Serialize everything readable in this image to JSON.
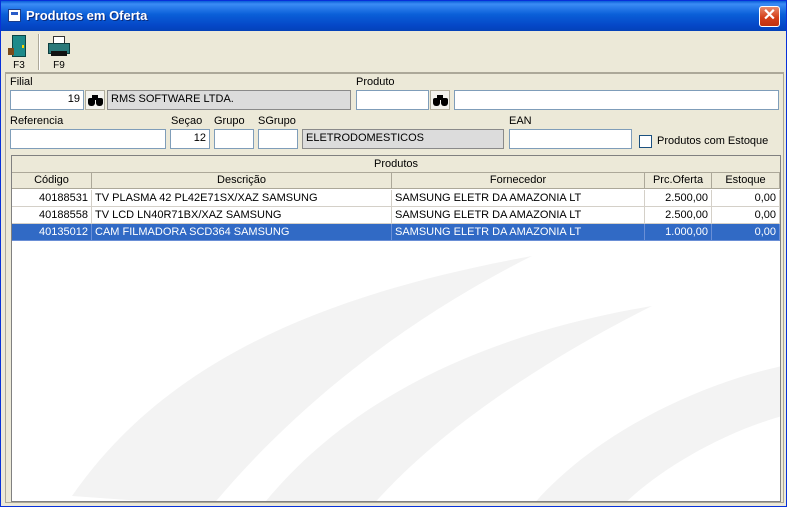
{
  "window": {
    "title": "Produtos em Oferta",
    "close_label": "✕"
  },
  "toolbar": {
    "buttons": [
      {
        "label": "F3",
        "icon": "exit-door-icon"
      },
      {
        "label": "F9",
        "icon": "printer-icon"
      }
    ]
  },
  "filters": {
    "filial_label": "Filial",
    "filial_value": "19",
    "filial_name": "RMS SOFTWARE LTDA.",
    "produto_label": "Produto",
    "produto_value": "",
    "produto_desc": "",
    "referencia_label": "Referencia",
    "referencia_value": "",
    "secao_label": "Seçao",
    "secao_value": "12",
    "grupo_label": "Grupo",
    "grupo_value": "",
    "sgrupo_label": "SGrupo",
    "sgrupo_value": "",
    "secao_desc": "ELETRODOMESTICOS",
    "ean_label": "EAN",
    "ean_value": "",
    "estoque_checkbox_label": "Produtos com Estoque",
    "estoque_checked": false
  },
  "grid": {
    "title": "Produtos",
    "columns": [
      "Código",
      "Descrição",
      "Fornecedor",
      "Prc.Oferta",
      "Estoque"
    ],
    "rows": [
      {
        "codigo": "40188531",
        "descricao": "TV PLASMA 42 PL42E71SX/XAZ SAMSUNG",
        "fornecedor": "SAMSUNG ELETR DA AMAZONIA LT",
        "preco": "2.500,00",
        "estoque": "0,00",
        "selected": false
      },
      {
        "codigo": "40188558",
        "descricao": "TV LCD LN40R71BX/XAZ SAMSUNG",
        "fornecedor": "SAMSUNG ELETR DA AMAZONIA LT",
        "preco": "2.500,00",
        "estoque": "0,00",
        "selected": false
      },
      {
        "codigo": "40135012",
        "descricao": "CAM FILMADORA SCD364 SAMSUNG",
        "fornecedor": "SAMSUNG ELETR DA AMAZONIA LT",
        "preco": "1.000,00",
        "estoque": "0,00",
        "selected": true
      }
    ]
  },
  "colors": {
    "selection": "#316ac5",
    "titlebar": "#0a5fd8",
    "face": "#ece9d8"
  }
}
